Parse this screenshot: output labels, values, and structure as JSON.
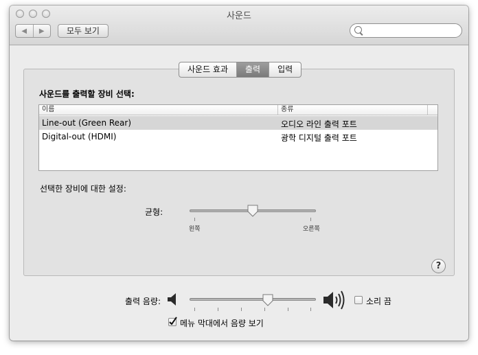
{
  "window": {
    "title": "사운드"
  },
  "toolbar": {
    "back_label": "◀",
    "forward_label": "▶",
    "show_all_label": "모두 보기",
    "search_placeholder": ""
  },
  "tabs": [
    {
      "label": "사운드 효과",
      "selected": false
    },
    {
      "label": "출력",
      "selected": true
    },
    {
      "label": "입력",
      "selected": false
    }
  ],
  "output": {
    "choose_label": "사운드를 출력할 장비 선택:",
    "columns": [
      "이름",
      "종류"
    ],
    "devices": [
      {
        "name": "Line-out (Green Rear)",
        "type": "오디오 라인 출력 포트",
        "selected": true
      },
      {
        "name": "Digital-out (HDMI)",
        "type": "광학 디지털 출력 포트",
        "selected": false
      }
    ],
    "settings_label": "선택한 장비에 대한 설정:",
    "balance": {
      "label": "균형:",
      "left_label": "왼쪽",
      "right_label": "오른쪽",
      "value": 0.5
    }
  },
  "help_label": "?",
  "volume": {
    "label": "출력 음량:",
    "value": 0.63,
    "mute_label": "소리 끔",
    "mute_checked": false,
    "menubar_label": "메뉴 막대에서 음량 보기",
    "menubar_checked": true
  }
}
